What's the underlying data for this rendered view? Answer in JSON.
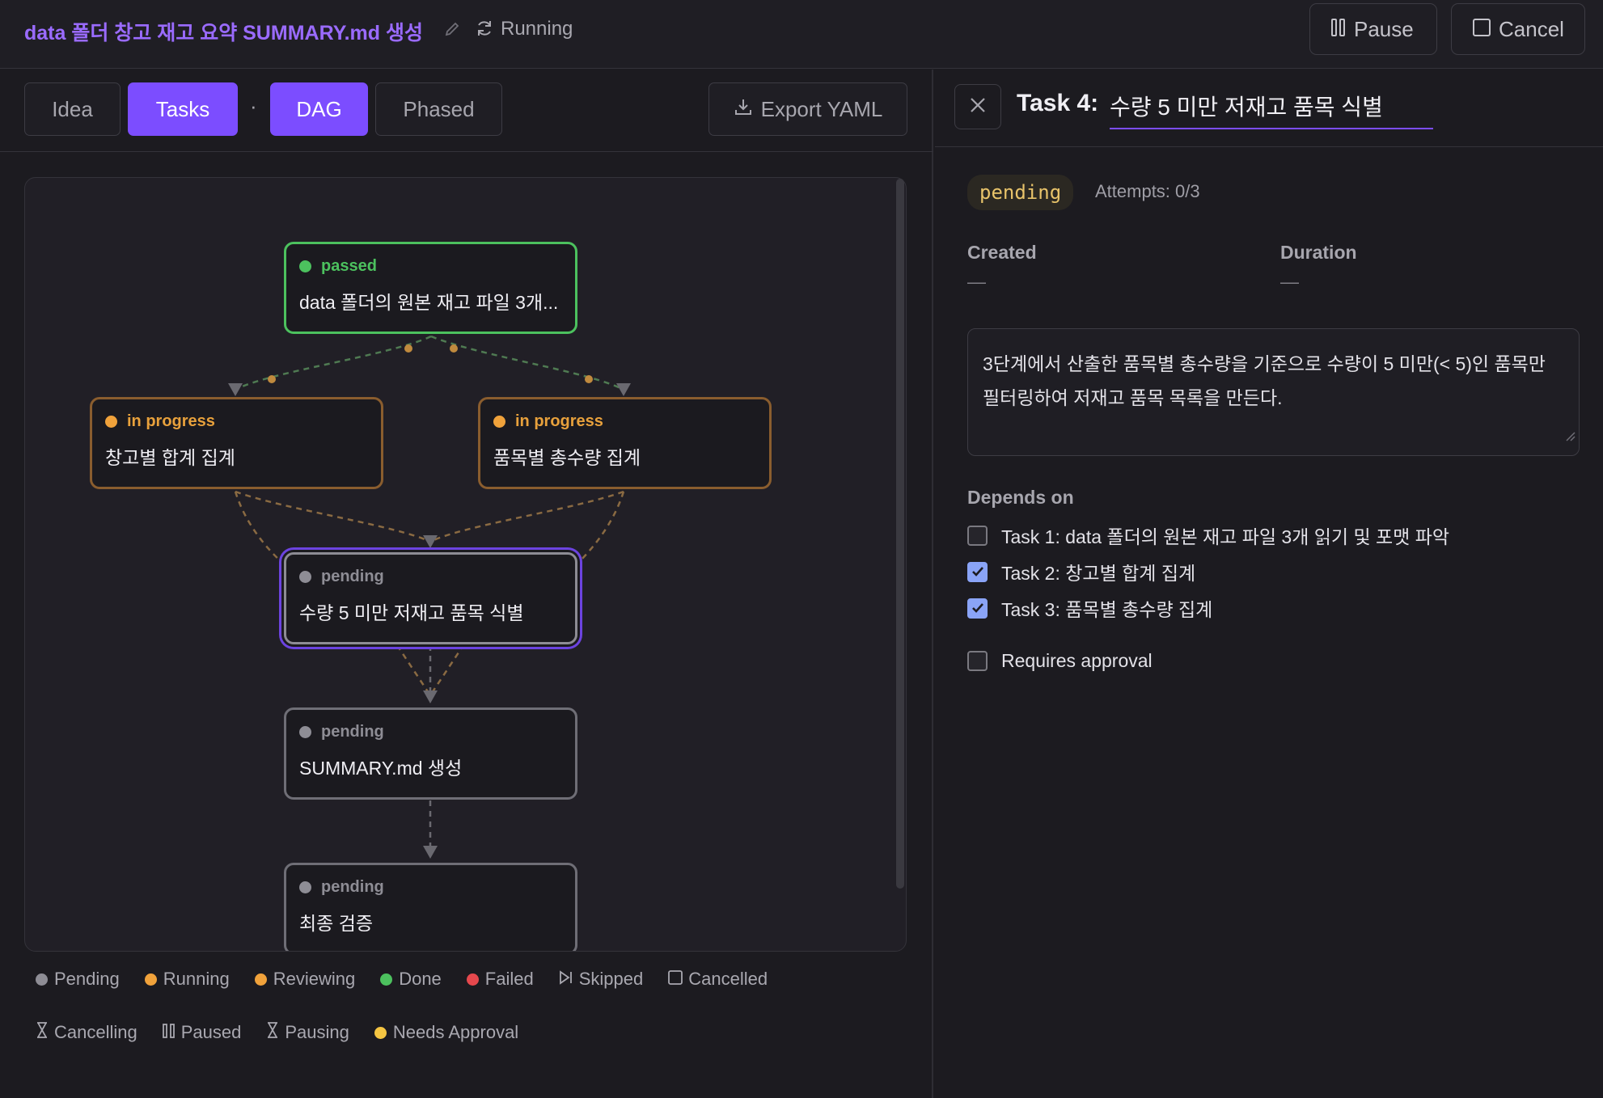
{
  "header": {
    "title": "data 폴더 창고 재고 요약 SUMMARY.md 생성",
    "status": "Running",
    "pause_label": "Pause",
    "cancel_label": "Cancel"
  },
  "tabs": {
    "idea": "Idea",
    "tasks": "Tasks",
    "separator": "·",
    "dag": "DAG",
    "phased": "Phased",
    "export": "Export YAML"
  },
  "dag": {
    "nodes": [
      {
        "status": "passed",
        "label": "data 폴더의 원본 재고 파일 3개..."
      },
      {
        "status": "in progress",
        "label": "창고별 합계 집계"
      },
      {
        "status": "in progress",
        "label": "품목별 총수량 집계"
      },
      {
        "status": "pending",
        "label": "수량 5 미만 저재고 품목 식별"
      },
      {
        "status": "pending",
        "label": "SUMMARY.md 생성"
      },
      {
        "status": "pending",
        "label": "최종 검증"
      }
    ]
  },
  "legend": {
    "pending": "Pending",
    "running": "Running",
    "reviewing": "Reviewing",
    "done": "Done",
    "failed": "Failed",
    "skipped": "Skipped",
    "cancelled": "Cancelled",
    "cancelling": "Cancelling",
    "paused": "Paused",
    "pausing": "Pausing",
    "needs_approval": "Needs Approval"
  },
  "detail": {
    "prefix": "Task 4:",
    "title": "수량 5 미만 저재고 품목 식별",
    "badge": "pending",
    "attempts": "Attempts: 0/3",
    "created_label": "Created",
    "created_value": "—",
    "duration_label": "Duration",
    "duration_value": "—",
    "description": "3단계에서 산출한 품목별 총수량을 기준으로 수량이 5 미만(< 5)인 품목만 필터링하여 저재고 품목 목록을 만든다.",
    "depends_label": "Depends on",
    "deps": [
      {
        "label": "Task 1: data 폴더의 원본 재고 파일 3개 읽기 및 포맷 파악",
        "checked": false
      },
      {
        "label": "Task 2: 창고별 합계 집계",
        "checked": true
      },
      {
        "label": "Task 3: 품목별 총수량 집계",
        "checked": true
      }
    ],
    "requires_approval": "Requires approval"
  },
  "colors": {
    "accent": "#7c4dff",
    "passed": "#4cc15e",
    "running": "#f0a23b",
    "pending": "#8e8d95",
    "failed": "#e5484d",
    "needs_approval": "#f5c542"
  }
}
